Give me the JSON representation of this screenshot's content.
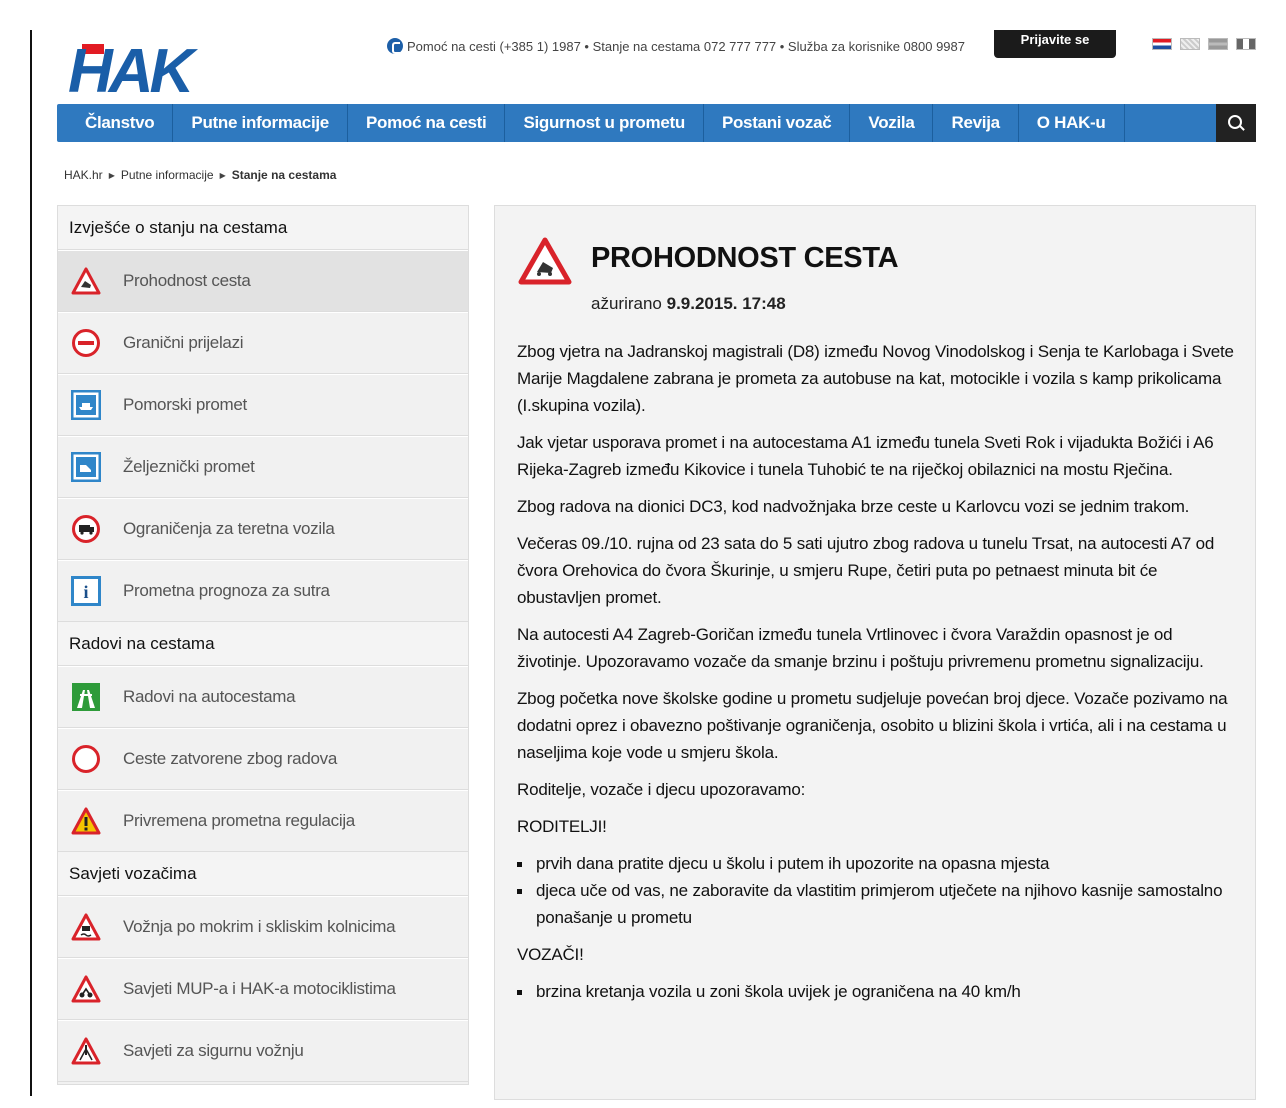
{
  "header": {
    "logo_text": "HAK",
    "contact": "Pomoć na cesti (+385 1) 1987 • Stanje na cestama 072 777 777 • Služba za korisnike 0800 9987",
    "login_label": "Prijavite se",
    "languages": [
      "hr-flag",
      "en-flag",
      "de-flag",
      "it-flag"
    ]
  },
  "nav": {
    "items": [
      "Članstvo",
      "Putne informacije",
      "Pomoć na cesti",
      "Sigurnost u prometu",
      "Postani vozač",
      "Vozila",
      "Revija",
      "O HAK-u"
    ]
  },
  "breadcrumb": [
    "HAK.hr",
    "Putne informacije",
    "Stanje na cestama"
  ],
  "sidebar": {
    "sections": [
      {
        "heading": "Izvješće o stanju na cestama",
        "items": [
          {
            "label": "Prohodnost cesta",
            "icon": "warning-triangle-icon"
          },
          {
            "label": "Granični prijelazi",
            "icon": "no-entry-icon"
          },
          {
            "label": "Pomorski promet",
            "icon": "ship-icon"
          },
          {
            "label": "Željeznički promet",
            "icon": "train-icon"
          },
          {
            "label": "Ograničenja za teretna vozila",
            "icon": "truck-restriction-icon"
          },
          {
            "label": "Prometna prognoza za sutra",
            "icon": "info-icon"
          }
        ]
      },
      {
        "heading": "Radovi na cestama",
        "items": [
          {
            "label": "Radovi na autocestama",
            "icon": "motorway-icon"
          },
          {
            "label": "Ceste zatvorene zbog radova",
            "icon": "closed-road-icon"
          },
          {
            "label": "Privremena prometna regulacija",
            "icon": "roadworks-triangle-icon"
          }
        ]
      },
      {
        "heading": "Savjeti vozačima",
        "items": [
          {
            "label": "Vožnja po mokrim i skliskim kolnicima",
            "icon": "slippery-road-icon"
          },
          {
            "label": "Savjeti MUP-a i HAK-a motociklistima",
            "icon": "motorcycle-triangle-icon"
          },
          {
            "label": "Savjeti za sigurnu vožnju",
            "icon": "caution-triangle-icon"
          }
        ]
      }
    ]
  },
  "content": {
    "title": "PROHODNOST CESTA",
    "updated_prefix": "ažurirano",
    "updated_date": "9.9.2015. 17:48",
    "paragraphs": [
      "Zbog vjetra na Jadranskoj magistrali (D8) između Novog Vinodolskog i Senja te Karlobaga i Svete Marije Magdalene zabrana je prometa za autobuse na kat, motocikle i vozila s kamp prikolicama (I.skupina vozila).",
      "Jak vjetar usporava promet i na autocestama A1 između tunela Sveti Rok i vijadukta Božići i A6 Rijeka-Zagreb između Kikovice i tunela Tuhobić te na riječkoj obilaznici na mostu Rječina.",
      "Zbog radova na dionici DC3, kod nadvožnjaka brze ceste u Karlovcu vozi se jednim trakom.",
      "Večeras 09./10. rujna od 23 sata do 5 sati ujutro zbog radova u tunelu Trsat, na autocesti A7 od čvora Orehovica do čvora Škurinje, u smjeru Rupe, četiri puta po petnaest minuta bit će obustavljen promet.",
      "Na autocesti A4 Zagreb-Goričan između tunela Vrtlinovec i čvora Varaždin opasnost je od životinje. Upozoravamo vozače da smanje brzinu i poštuju privremenu prometnu signalizaciju.",
      "Zbog početka nove školske godine u prometu sudjeluje povećan broj djece. Vozače pozivamo na dodatni oprez i obavezno poštivanje ograničenja, osobito u blizini škola i vrtića, ali i na cestama u naseljima koje vode u smjeru škola.",
      "Roditelje, vozače i djecu upozoravamo:"
    ],
    "parents_heading": "RODITELJI!",
    "parents_list": [
      "prvih dana pratite djecu u školu i putem ih upozorite na opasna mjesta",
      "djeca uče od vas, ne zaboravite da vlastitim primjerom utječete na njihovo kasnije samostalno ponašanje u prometu"
    ],
    "drivers_heading": "VOZAČI!",
    "drivers_list": [
      "brzina kretanja vozila u zoni škola uvijek je ograničena na 40 km/h"
    ]
  },
  "colors": {
    "nav_blue": "#2f79bf",
    "logo_blue": "#1a5ea8",
    "logo_red": "#e21b23",
    "warning_red": "#d9232a"
  }
}
